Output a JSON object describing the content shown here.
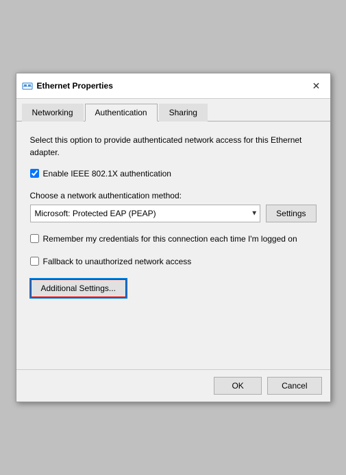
{
  "window": {
    "title": "Ethernet Properties",
    "close_label": "✕"
  },
  "tabs": [
    {
      "id": "networking",
      "label": "Networking",
      "active": false
    },
    {
      "id": "authentication",
      "label": "Authentication",
      "active": true
    },
    {
      "id": "sharing",
      "label": "Sharing",
      "active": false
    }
  ],
  "content": {
    "description": "Select this option to provide authenticated network access for this Ethernet adapter.",
    "enable_ieee_label": "Enable IEEE 802.1X authentication",
    "enable_ieee_checked": true,
    "choose_method_label": "Choose a network authentication method:",
    "dropdown_value": "Microsoft: Protected EAP (PEAP)",
    "settings_button_label": "Settings",
    "remember_credentials_label": "Remember my credentials for this connection each time I'm logged on",
    "remember_credentials_checked": false,
    "fallback_label": "Fallback to unauthorized network access",
    "fallback_checked": false,
    "additional_settings_label": "Additional Settings..."
  },
  "footer": {
    "ok_label": "OK",
    "cancel_label": "Cancel"
  }
}
